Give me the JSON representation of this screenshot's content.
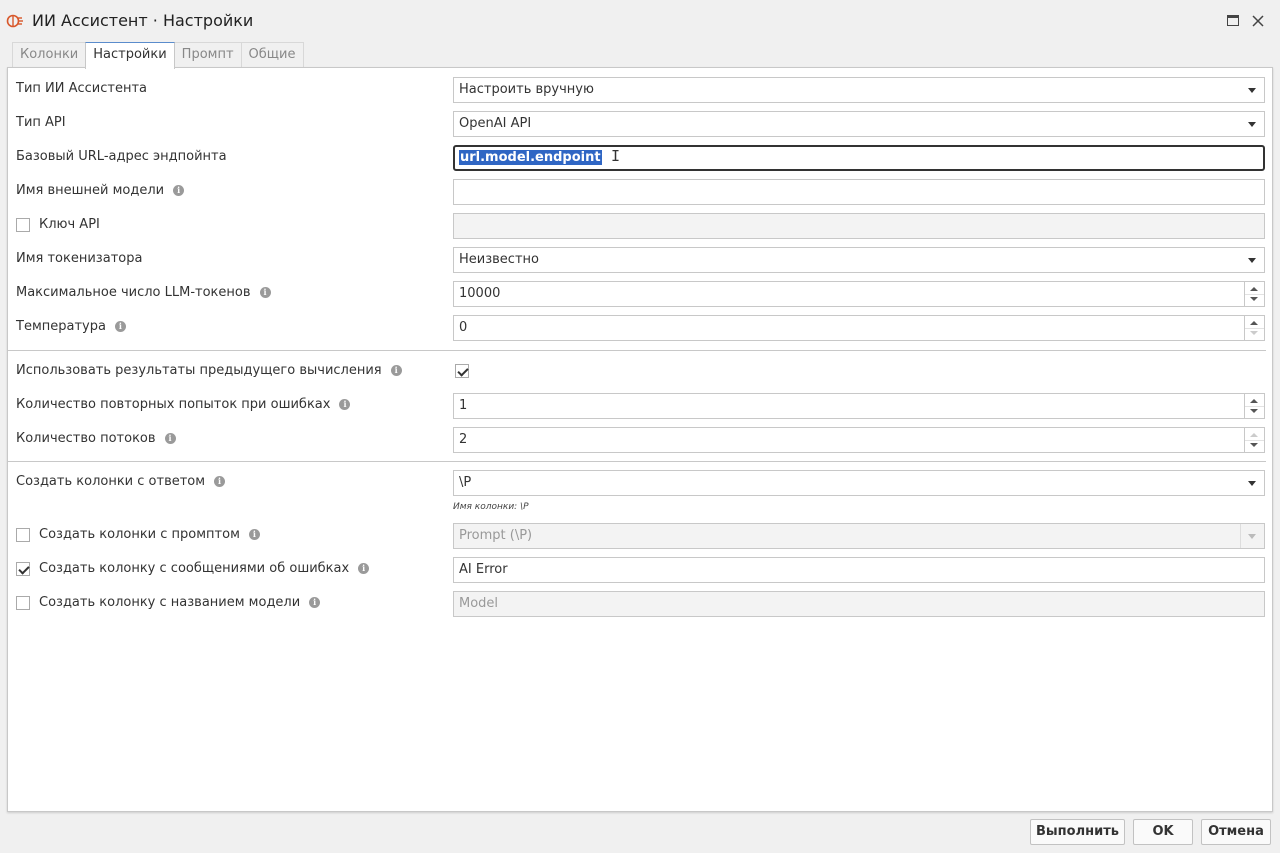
{
  "window": {
    "title": "ИИ Ассистент · Настройки",
    "icon": "ai-brain-icon"
  },
  "tabs": [
    {
      "label": "Колонки",
      "active": false
    },
    {
      "label": "Настройки",
      "active": true
    },
    {
      "label": "Промпт",
      "active": false
    },
    {
      "label": "Общие",
      "active": false
    }
  ],
  "fields": {
    "assistant_type": {
      "label": "Тип ИИ Ассистента",
      "value": "Настроить вручную"
    },
    "api_type": {
      "label": "Тип API",
      "value": "OpenAI API"
    },
    "endpoint": {
      "label": "Базовый URL-адрес эндпойнта",
      "value": "url.model.endpoint"
    },
    "external_model": {
      "label": "Имя внешней модели",
      "value": ""
    },
    "api_key": {
      "label": "Ключ API",
      "checked": false,
      "value": ""
    },
    "tokenizer": {
      "label": "Имя токенизатора",
      "value": "Неизвестно"
    },
    "max_tokens": {
      "label": "Максимальное число LLM-токенов",
      "value": "10000"
    },
    "temperature": {
      "label": "Температура",
      "value": "0"
    },
    "use_previous": {
      "label": "Использовать результаты предыдущего вычисления",
      "checked": true
    },
    "retries": {
      "label": "Количество повторных попыток при ошибках",
      "value": "1"
    },
    "threads": {
      "label": "Количество потоков",
      "value": "2"
    },
    "answer_columns": {
      "label": "Создать колонки с ответом",
      "value": "\\P",
      "hint": "Имя колонки: \\P"
    },
    "prompt_columns": {
      "label": "Создать колонки с промптом",
      "checked": false,
      "value": "Prompt (\\P)"
    },
    "error_column": {
      "label": "Создать колонку с сообщениями об ошибках",
      "checked": true,
      "value": "AI Error"
    },
    "model_column": {
      "label": "Создать колонку с названием модели",
      "checked": false,
      "value": "Model"
    }
  },
  "buttons": {
    "run": "Выполнить",
    "ok": "OK",
    "cancel": "Отмена"
  },
  "colors": {
    "accent": "#2f66c4",
    "tab_border": "#5a8ccc"
  }
}
